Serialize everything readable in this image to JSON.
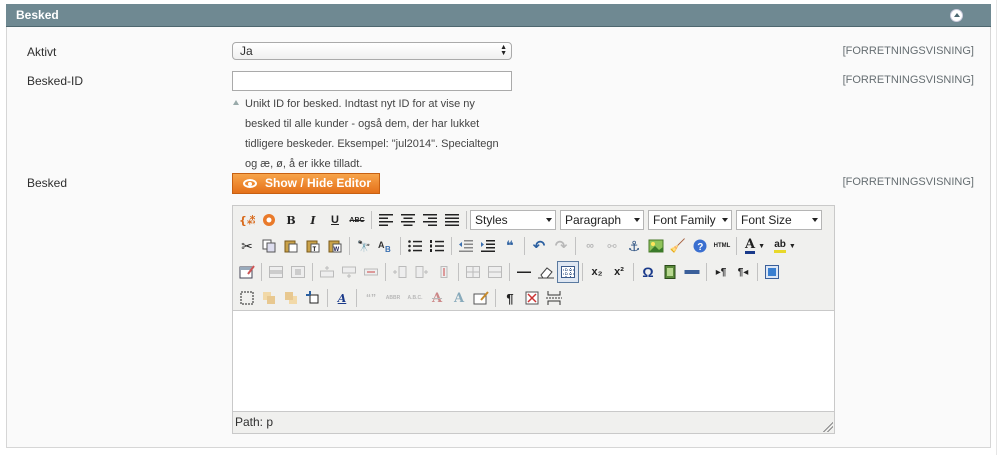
{
  "section": {
    "title": "Besked"
  },
  "rows": {
    "active": {
      "label": "Aktivt",
      "value": "Ja",
      "scope": "[FORRETNINGSVISNING]"
    },
    "message_id": {
      "label": "Besked-ID",
      "value": "",
      "scope": "[FORRETNINGSVISNING]",
      "note_lines": [
        "Unikt ID for besked. Indtast nyt ID for at vise ny",
        "besked til alle kunder - også dem, der har lukket",
        "tidligere beskeder. Eksempel: \"jul2014\". Specialtegn",
        "og æ, ø, å er ikke tilladt."
      ]
    },
    "message": {
      "label": "Besked",
      "scope": "[FORRETNINGSVISNING]",
      "toggle_button": "Show / Hide Editor"
    }
  },
  "editor": {
    "format_selects": {
      "styles": "Styles",
      "paragraph": "Paragraph",
      "font_family": "Font Family",
      "font_size": "Font Size"
    },
    "toolbar_glyphs": {
      "bold": "B",
      "italic": "I",
      "underline": "U",
      "strike": "ABC",
      "omega": "Ω",
      "html": "HTML",
      "pilcrow": "¶",
      "subscript": "x₂",
      "superscript": "x²",
      "blockquote": "❝",
      "cite": "“”",
      "abbr": "ABBR",
      "acronym": "A.B.C.",
      "font_color": "A",
      "highlight": "ab"
    },
    "status_path": "Path: p"
  }
}
